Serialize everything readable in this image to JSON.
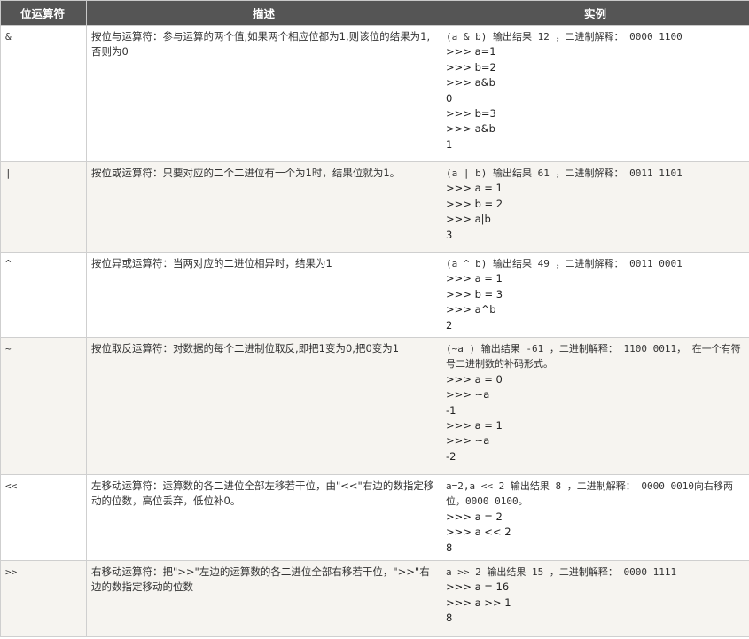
{
  "headers": {
    "operator": "位运算符",
    "description": "描述",
    "example": "实例"
  },
  "rows": [
    {
      "operator": "&",
      "description": "按位与运算符：参与运算的两个值,如果两个相应位都为1,则该位的结果为1,否则为0",
      "example": [
        "(a & b) 输出结果 12 ，二进制解释： 0000 1100",
        ">>> a=1",
        ">>> b=2",
        ">>> a&b",
        "0",
        ">>> b=3",
        ">>> a&b",
        "1"
      ]
    },
    {
      "operator": "|",
      "description": "按位或运算符：只要对应的二个二进位有一个为1时，结果位就为1。",
      "example": [
        "(a | b) 输出结果 61 ，二进制解释： 0011 1101",
        ">>> a = 1",
        ">>> b = 2",
        ">>> a|b",
        "3"
      ]
    },
    {
      "operator": "^",
      "description": "按位异或运算符：当两对应的二进位相异时，结果为1",
      "example": [
        "(a ^ b) 输出结果 49 ，二进制解释： 0011 0001",
        ">>> a = 1",
        ">>> b = 3",
        ">>> a^b",
        "2"
      ]
    },
    {
      "operator": "~",
      "description": "按位取反运算符：对数据的每个二进制位取反,即把1变为0,把0变为1",
      "example": [
        "(~a ) 输出结果 -61 ，二进制解释： 1100 0011， 在一个有符号二进制数的补码形式。",
        ">>> a = 0",
        ">>> ~a",
        "-1",
        ">>> a = 1",
        ">>> ~a",
        "-2"
      ]
    },
    {
      "operator": "<<",
      "description": "左移动运算符：运算数的各二进位全部左移若干位，由\"<<\"右边的数指定移动的位数，高位丢弃，低位补0。",
      "example": [
        "a=2,a << 2 输出结果 8 ，二进制解释： 0000 0010向右移两位，0000 0100。",
        ">>> a = 2",
        ">>> a << 2",
        "8"
      ]
    },
    {
      "operator": ">>",
      "description": "右移动运算符：把\">>\"左边的运算数的各二进位全部右移若干位，\">>\"右边的数指定移动的位数",
      "example": [
        "a >> 2 输出结果 15 ，二进制解释： 0000 1111",
        ">>> a = 16",
        ">>> a >> 1",
        "8"
      ]
    }
  ]
}
